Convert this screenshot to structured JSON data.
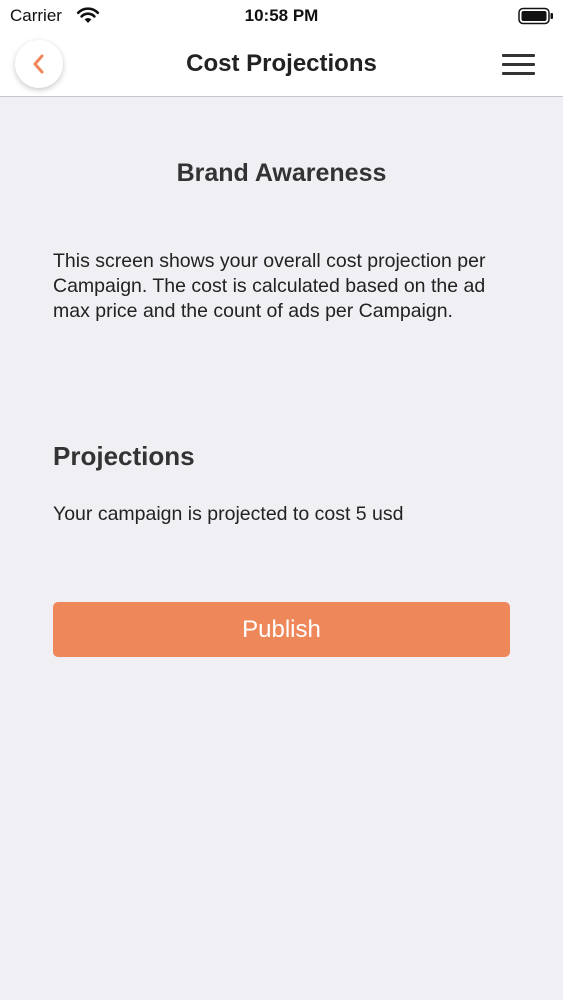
{
  "status_bar": {
    "carrier": "Carrier",
    "time": "10:58 PM",
    "wifi_icon": "wifi-icon",
    "battery_icon": "battery-icon"
  },
  "nav": {
    "title": "Cost Projections",
    "back_icon": "chevron-left-icon",
    "menu_icon": "hamburger-menu-icon"
  },
  "content": {
    "campaign_title": "Brand Awareness",
    "description": "This screen shows your overall cost projection per Campaign. The cost is calculated based on the ad max price and the count of ads per Campaign.",
    "section_heading": "Projections",
    "projection_text": "Your campaign is projected to cost 5 usd",
    "publish_label": "Publish"
  },
  "colors": {
    "accent": "#ee875a",
    "background": "#efeff4",
    "nav_background": "#ffffff"
  }
}
